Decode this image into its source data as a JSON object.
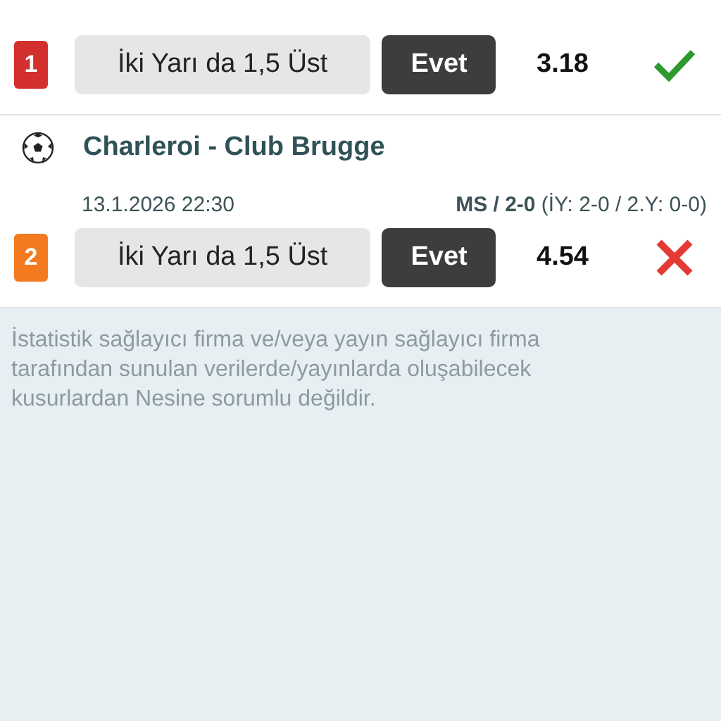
{
  "matches": [
    {
      "bet": {
        "number": "1",
        "color": "#d32f2f",
        "market": "İki Yarı da 1,5 Üst",
        "pick": "Evet",
        "odds": "3.18",
        "kind": "won"
      }
    },
    {
      "title": "Charleroi - Club Brugge",
      "date": "13.1.2026 22:30",
      "score": "**MS / 2-0** (İY: 2-0 / 2.Y: 0-0)",
      "bet": {
        "number": "2",
        "color": "#f47a20",
        "market": "İki Yarı da 1,5 Üst",
        "pick": "Evet",
        "odds": "4.54",
        "kind": "lost"
      }
    }
  ],
  "disclaimer": "İstatistik sağlayıcı firma ve/veya yayın sağlayıcı firma tarafından sunulan verilerde/yayınlarda oluşabilecek kusurlardan Nesine sorumlu değildir."
}
